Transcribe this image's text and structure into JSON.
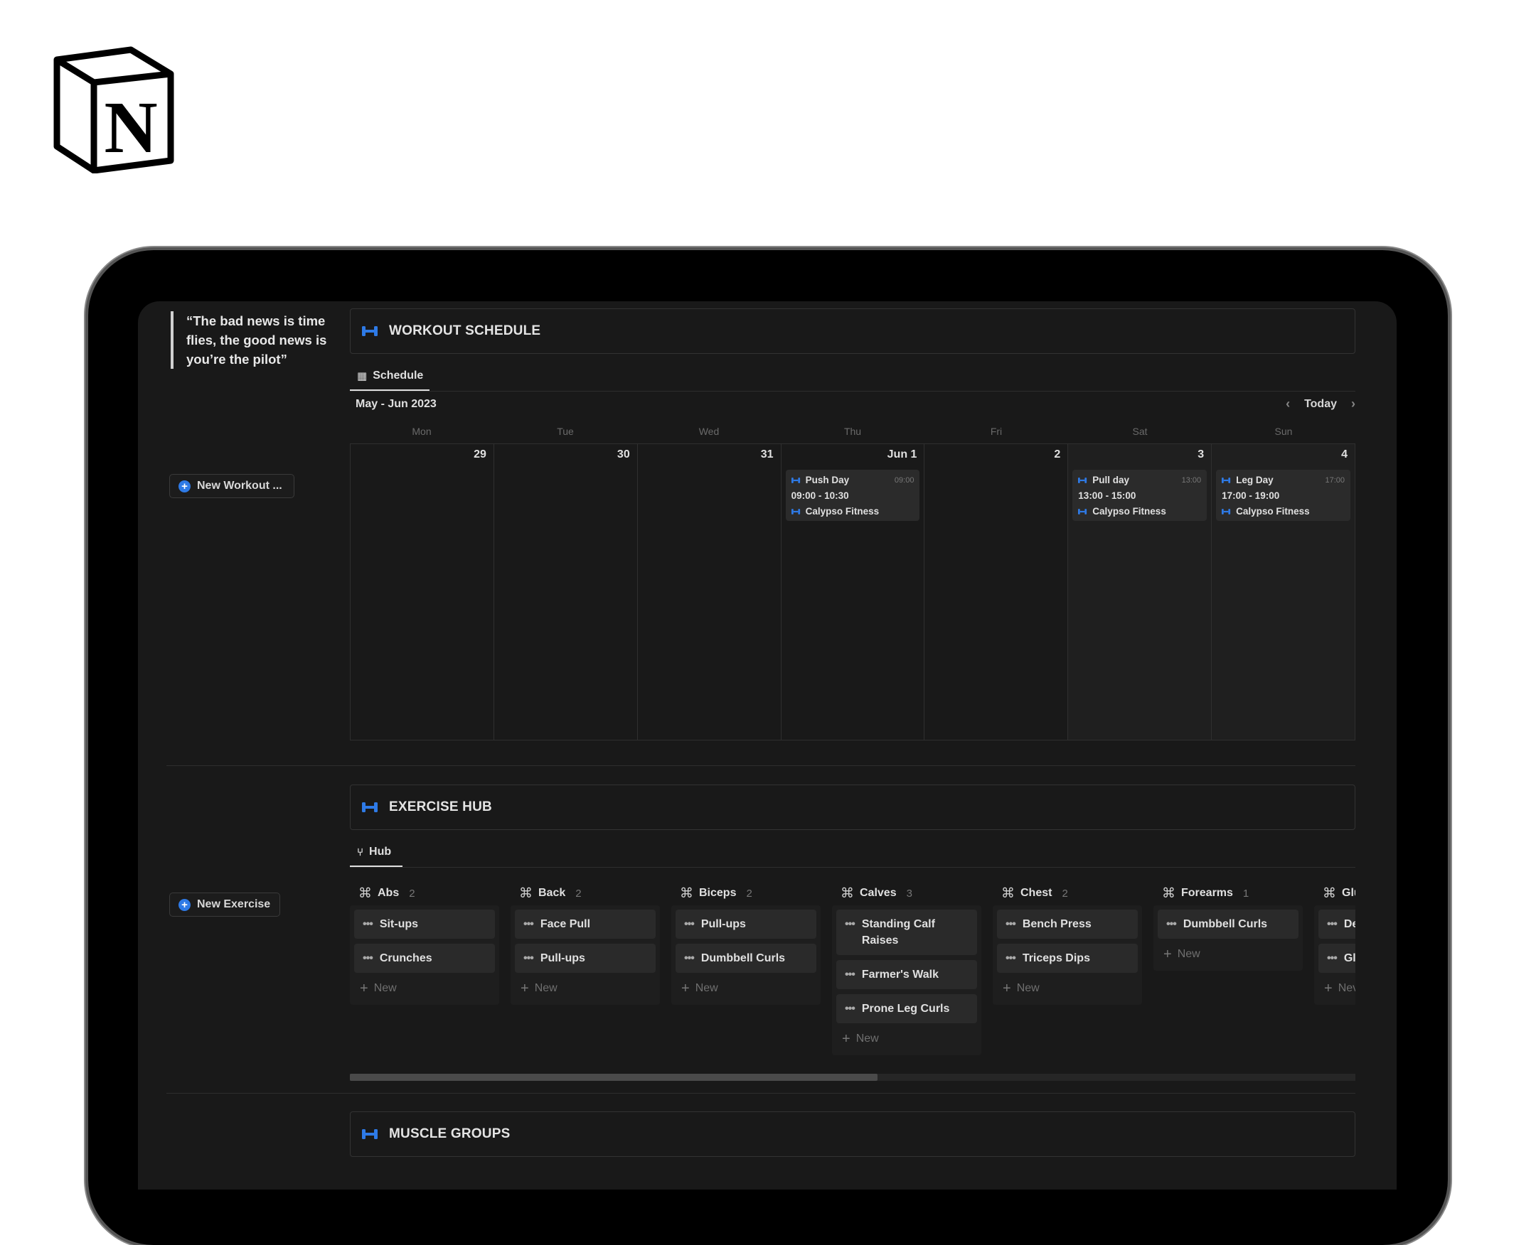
{
  "quote": "“The bad news is time flies, the good news is you’re the pilot”",
  "sidebar": {
    "new_workout": "New Workout ...",
    "new_exercise": "New Exercise"
  },
  "schedule": {
    "title": "WORKOUT SCHEDULE",
    "tab": "Schedule",
    "month": "May - Jun 2023",
    "today": "Today",
    "days_of_week": [
      "Mon",
      "Tue",
      "Wed",
      "Thu",
      "Fri",
      "Sat",
      "Sun"
    ],
    "dates": [
      "29",
      "30",
      "31",
      "Jun 1",
      "2",
      "3",
      "4"
    ],
    "events": [
      {
        "day": 3,
        "name": "Push Day",
        "start": "09:00",
        "range": "09:00 - 10:30",
        "place": "Calypso Fitness"
      },
      {
        "day": 5,
        "name": "Pull day",
        "start": "13:00",
        "range": "13:00 - 15:00",
        "place": "Calypso Fitness"
      },
      {
        "day": 6,
        "name": "Leg Day",
        "start": "17:00",
        "range": "17:00 - 19:00",
        "place": "Calypso Fitness"
      }
    ]
  },
  "hub": {
    "title": "EXERCISE HUB",
    "tab": "Hub",
    "new_label": "New",
    "groups": [
      {
        "name": "Abs",
        "count": "2",
        "items": [
          "Sit-ups",
          "Crunches"
        ]
      },
      {
        "name": "Back",
        "count": "2",
        "items": [
          "Face Pull",
          "Pull-ups"
        ]
      },
      {
        "name": "Biceps",
        "count": "2",
        "items": [
          "Pull-ups",
          "Dumbbell Curls"
        ]
      },
      {
        "name": "Calves",
        "count": "3",
        "items": [
          "Standing Calf Raises",
          "Farmer's Walk",
          "Prone Leg Curls"
        ]
      },
      {
        "name": "Chest",
        "count": "2",
        "items": [
          "Bench Press",
          "Triceps Dips"
        ]
      },
      {
        "name": "Forearms",
        "count": "1",
        "items": [
          "Dumbbell Curls"
        ]
      },
      {
        "name": "Glu",
        "count": "",
        "items": [
          "De",
          "Gl"
        ]
      }
    ],
    "last_new_label": "Nev"
  },
  "muscle": {
    "title": "MUSCLE GROUPS"
  },
  "scroll_fraction": 0.525
}
